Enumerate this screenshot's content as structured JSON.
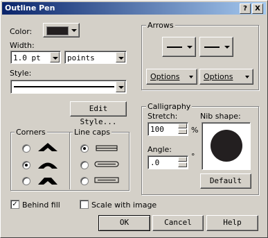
{
  "title": "Outline Pen",
  "titlebar": {
    "help_label": "?",
    "close_label": "X"
  },
  "color": {
    "label": "Color:",
    "swatch": "#231f20"
  },
  "width": {
    "label": "Width:",
    "value": "1.0 pt",
    "units": "points"
  },
  "style": {
    "label": "Style:"
  },
  "edit_style_label": "Edit Style...",
  "corners": {
    "label": "Corners"
  },
  "line_caps": {
    "label": "Line caps"
  },
  "arrows": {
    "label": "Arrows",
    "options_left": "Options",
    "options_right": "Options"
  },
  "calligraphy": {
    "label": "Calligraphy",
    "stretch_label": "Stretch:",
    "stretch_value": "100",
    "stretch_unit": "%",
    "angle_label": "Angle:",
    "angle_value": ".0",
    "angle_unit": "°",
    "nib_label": "Nib shape:",
    "default_label": "Default"
  },
  "behind_fill": {
    "label": "Behind fill",
    "checked": true
  },
  "scale_with_image": {
    "label": "Scale with image",
    "checked": false
  },
  "buttons": {
    "ok": "OK",
    "cancel": "Cancel",
    "help": "Help"
  }
}
